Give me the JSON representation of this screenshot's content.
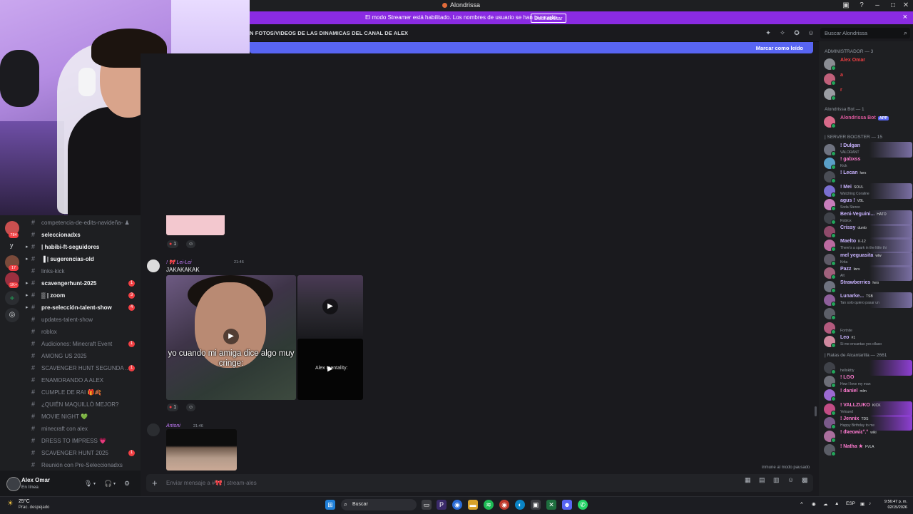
{
  "window": {
    "title": "Alondrissa"
  },
  "banner": {
    "text": "El modo Streamer está habilitado. Los nombres de usuario se han truncado.",
    "button": "Deshabilitar",
    "close": "×"
  },
  "channel_header": {
    "name": "N FOTOS/VIDEOS DE LAS DINAMICAS DEL CANAL DE ALEX",
    "search_placeholder": "Buscar Alondrissa"
  },
  "new_messages": {
    "label": "Marcar como leído"
  },
  "server_rail": {
    "badges": [
      "784",
      "17",
      "1K+"
    ],
    "letter": "y"
  },
  "channels": [
    {
      "label": "competencia-de-edits-navideña- ♟",
      "bright": false,
      "badge": "",
      "arrow": false
    },
    {
      "label": "seleccionadxs",
      "bright": true,
      "badge": "",
      "arrow": false
    },
    {
      "label": "| habibi-ft-seguidores",
      "bright": true,
      "badge": "",
      "arrow": true
    },
    {
      "label": "▐  | sugerencias-old",
      "bright": true,
      "badge": "",
      "arrow": true
    },
    {
      "label": "links-kick",
      "bright": false,
      "badge": "",
      "arrow": false
    },
    {
      "label": "scavengerhunt-2025",
      "bright": true,
      "badge": "1",
      "arrow": true
    },
    {
      "label": "▒ | zoom",
      "bright": true,
      "badge": "3",
      "arrow": true
    },
    {
      "label": "pre-selección-talent-show",
      "bright": true,
      "badge": "4",
      "arrow": true
    },
    {
      "label": "updates-talent-show",
      "bright": false,
      "badge": "",
      "arrow": false
    },
    {
      "label": "roblox",
      "bright": false,
      "badge": "",
      "arrow": false
    },
    {
      "label": "Audiciones: Minecraft Event",
      "bright": false,
      "badge": "1",
      "arrow": false
    },
    {
      "label": "AMONG US 2025",
      "bright": false,
      "badge": "",
      "arrow": false
    },
    {
      "label": "SCAVENGER HUNT SEGUNDA ...",
      "bright": false,
      "badge": "1",
      "arrow": false
    },
    {
      "label": "ENAMORANDO A ALEX",
      "bright": false,
      "badge": "",
      "arrow": false
    },
    {
      "label": "CUMPLE DE RAI 🎁🍂",
      "bright": false,
      "badge": "",
      "arrow": false
    },
    {
      "label": "¿QUIÉN MAQUILLÓ MEJOR?",
      "bright": false,
      "badge": "",
      "arrow": false
    },
    {
      "label": "MOVIE NIGHT 💚",
      "bright": false,
      "badge": "",
      "arrow": false
    },
    {
      "label": "minecraft con alex",
      "bright": false,
      "badge": "",
      "arrow": false
    },
    {
      "label": "DRESS TO IMPRESS 💗",
      "bright": false,
      "badge": "",
      "arrow": false
    },
    {
      "label": "SCAVENGER HUNT 2025",
      "bright": false,
      "badge": "1",
      "arrow": false
    },
    {
      "label": "Reunión con Pre-Seleccionadxs",
      "bright": false,
      "badge": "",
      "arrow": false
    }
  ],
  "user_panel": {
    "name": "Alex Omar",
    "status": "En línea"
  },
  "messages": [
    {
      "reaction_count": "1"
    },
    {
      "author": "! 🎀 Lei-Lei",
      "time": "21:46",
      "text": "JAKAKAKAK",
      "video_caption": "yo cuando mi amiga dice algo muy cringe:",
      "video3_text": "Alex mentality:",
      "reaction_count": "1"
    },
    {
      "author": "Antoni",
      "time": "21:46"
    }
  ],
  "composer": {
    "placeholder": "Enviar mensaje a #🎀 | stream-ales",
    "immune": "inmune al modo pausado"
  },
  "members": {
    "groups": [
      {
        "header": "ADMINISTRADOR — 3",
        "items": [
          {
            "name": "Alex Omar",
            "color": "#f23f43",
            "sub": "",
            "tag": "",
            "role": ""
          },
          {
            "name": "a",
            "color": "#f23f43",
            "sub": "",
            "tag": "",
            "role": ""
          },
          {
            "name": "r",
            "color": "#f23f43",
            "sub": "",
            "tag": "",
            "role": ""
          }
        ]
      },
      {
        "header": "Alondrissa Bot — 1",
        "items": [
          {
            "name": "Alondrissa Bot",
            "color": "#e05aa0",
            "sub": "",
            "tag": "APP",
            "role": ""
          }
        ]
      },
      {
        "header": "| SERVER BOOSTER — 15",
        "items": [
          {
            "name": "! Dulgan",
            "color": "#c9b3ff",
            "sub": "VALORANT",
            "tag": "",
            "role": ""
          },
          {
            "name": "! gabxss",
            "color": "#ff7bd0",
            "sub": "Kick",
            "tag": "",
            "role": ""
          },
          {
            "name": "! Lecan",
            "color": "#c9b3ff",
            "sub": "",
            "tag": "",
            "role": "lwrs"
          },
          {
            "name": "! Mei",
            "color": "#c9b3ff",
            "sub": "Watching Coraline",
            "tag": "",
            "role": "SOUL"
          },
          {
            "name": "agus !",
            "color": "#c9b3ff",
            "sub": "Soda Stereo",
            "tag": "",
            "role": "VBL"
          },
          {
            "name": "Beni-Veguini...",
            "color": "#c9b3ff",
            "sub": "Roblox",
            "tag": "",
            "role": "HATO"
          },
          {
            "name": "Crissy",
            "color": "#c9b3ff",
            "sub": "",
            "tag": "",
            "role": "dumb"
          },
          {
            "name": "Maelto",
            "color": "#c9b3ff",
            "sub": "There's a spark in the little thi",
            "tag": "",
            "role": "K-12"
          },
          {
            "name": "mel yeguasita",
            "color": "#c9b3ff",
            "sub": "Krita",
            "tag": "",
            "role": "wlw"
          },
          {
            "name": "Pazz",
            "color": "#c9b3ff",
            "sub": "Alt",
            "tag": "",
            "role": "lwrs"
          },
          {
            "name": "Strawberries",
            "color": "#c9b3ff",
            "sub": "",
            "tag": "",
            "role": "lwrs"
          },
          {
            "name": "Lunarke...",
            "color": "#c9b3ff",
            "sub": "Tan solo quiero pasar un",
            "tag": "",
            "role": "TSB"
          },
          {
            "name": "",
            "color": "#c9b3ff",
            "sub": "",
            "tag": "",
            "role": ""
          },
          {
            "name": "",
            "color": "#c9b3ff",
            "sub": "Fortnite",
            "tag": "",
            "role": ""
          },
          {
            "name": "Leo",
            "color": "#c9b3ff",
            "sub": "Si me encantas yes ollaso",
            "tag": "",
            "role": "#1"
          }
        ]
      },
      {
        "header": "| Ratas de Alcantarilla — 2661",
        "items": [
          {
            "name": "",
            "color": "#ff7bd0",
            "sub": "hellokitty",
            "tag": "",
            "role": ""
          },
          {
            "name": "! LGO",
            "color": "#ff7bd0",
            "sub": "How I love my man",
            "tag": "",
            "role": ""
          },
          {
            "name": "! daniel",
            "color": "#ff7bd0",
            "sub": "",
            "tag": "",
            "role": "mlm"
          },
          {
            "name": "! VALLZUKO",
            "color": "#ff7bd0",
            "sub": "Yeloued",
            "tag": "",
            "role": "KICK"
          },
          {
            "name": "! Jennix",
            "color": "#ff7bd0",
            "sub": "Happy Birthday to me",
            "tag": "",
            "role": "TDS"
          },
          {
            "name": "! ᵭʀeɑʍiɛ°.°",
            "color": "#ff7bd0",
            "sub": "",
            "tag": "",
            "role": "wiki"
          },
          {
            "name": "! Natha ★",
            "color": "#ff7bd0",
            "sub": "",
            "tag": "",
            "role": "FVLA"
          }
        ]
      }
    ]
  },
  "taskbar": {
    "temp": "25°C",
    "condition": "Prac. despejado",
    "search": "Buscar",
    "lang": "ESP",
    "time": "9:56:47 p. m.",
    "date": "02/15/2026"
  }
}
